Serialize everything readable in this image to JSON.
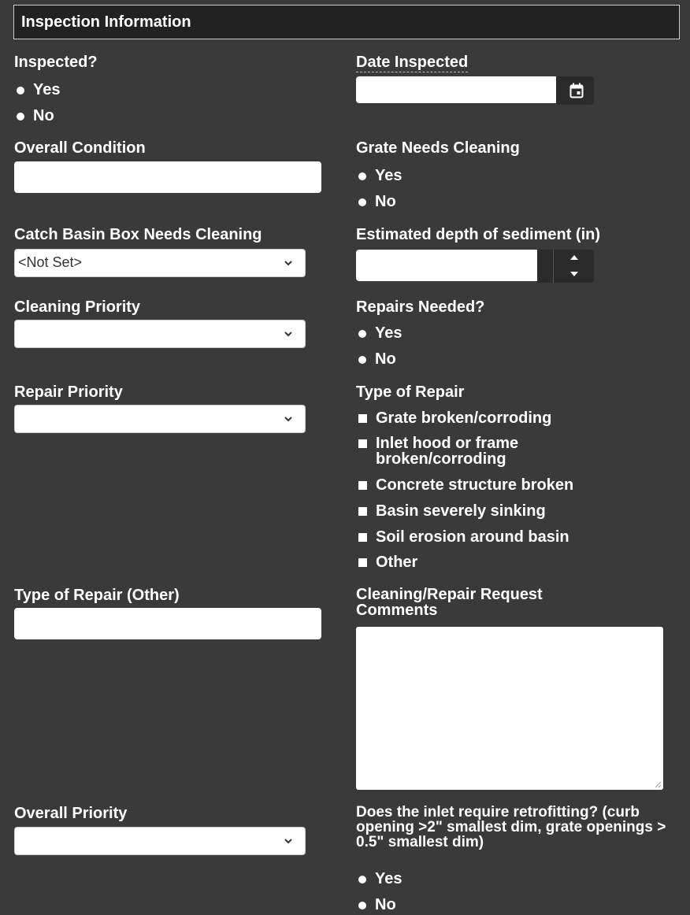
{
  "header": {
    "title": "Inspection Information"
  },
  "inspected": {
    "label": "Inspected?",
    "options": [
      "Yes",
      "No"
    ]
  },
  "date_inspected": {
    "label": "Date Inspected",
    "value": ""
  },
  "overall_condition": {
    "label": "Overall Condition",
    "value": ""
  },
  "grate_needs_cleaning": {
    "label": "Grate Needs Cleaning",
    "options": [
      "Yes",
      "No"
    ]
  },
  "catch_basin": {
    "label": "Catch Basin Box Needs Cleaning",
    "selected": "<Not Set>"
  },
  "sediment_depth": {
    "label": "Estimated depth of sediment (in)",
    "value": ""
  },
  "cleaning_priority": {
    "label": "Cleaning Priority",
    "selected": ""
  },
  "repairs_needed": {
    "label": "Repairs Needed?",
    "options": [
      "Yes",
      "No"
    ]
  },
  "repair_priority": {
    "label": "Repair Priority",
    "selected": ""
  },
  "type_of_repair": {
    "label": "Type of Repair",
    "options": [
      "Grate broken/corroding",
      "Inlet hood or frame broken/corroding",
      "Concrete structure broken",
      "Basin severely sinking",
      "Soil erosion around basin",
      "Other"
    ]
  },
  "type_of_repair_other": {
    "label": "Type of Repair (Other)",
    "value": ""
  },
  "comments": {
    "label": "Cleaning/Repair Request Comments",
    "value": ""
  },
  "overall_priority": {
    "label": "Overall Priority",
    "selected": ""
  },
  "retrofitting": {
    "label": "Does the inlet require retrofitting? (curb opening >2\" smallest dim, grate openings > 0.5\" smallest dim)",
    "options": [
      "Yes",
      "No"
    ]
  },
  "icons": {
    "calendar": "calendar-icon",
    "spin_up": "chevron-up-icon",
    "spin_down": "chevron-down-icon",
    "select_arrow": "chevron-down-icon"
  }
}
